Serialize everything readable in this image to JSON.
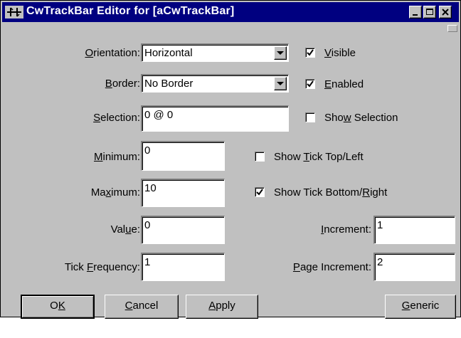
{
  "window": {
    "title": "CwTrackBar Editor for [aCwTrackBar]"
  },
  "orientation": {
    "label_pre": "",
    "label_key": "O",
    "label_post": "rientation:",
    "value": "Horizontal"
  },
  "border": {
    "label_pre": "",
    "label_key": "B",
    "label_post": "order:",
    "value": "No Border"
  },
  "selection": {
    "label_pre": "",
    "label_key": "S",
    "label_post": "election:",
    "value": "0 @ 0"
  },
  "minimum": {
    "label_pre": "",
    "label_key": "M",
    "label_post": "inimum:",
    "value": "0"
  },
  "maximum": {
    "label_pre": "Ma",
    "label_key": "x",
    "label_post": "imum:",
    "value": "10"
  },
  "value_field": {
    "label_pre": "Val",
    "label_key": "u",
    "label_post": "e:",
    "value": "0"
  },
  "tick_frequency": {
    "label_pre": "Tick ",
    "label_key": "F",
    "label_post": "requency:",
    "value": "1"
  },
  "increment": {
    "label_pre": "",
    "label_key": "I",
    "label_post": "ncrement:",
    "value": "1"
  },
  "page_increment": {
    "label_pre": "",
    "label_key": "P",
    "label_post": "age Increment:",
    "value": "2"
  },
  "visible": {
    "pre": "",
    "key": "V",
    "post": "isible",
    "checked": true
  },
  "enabled": {
    "pre": "",
    "key": "E",
    "post": "nabled",
    "checked": true
  },
  "show_selection": {
    "pre": "Sho",
    "key": "w",
    "post": " Selection",
    "checked": false
  },
  "show_tick_top_left": {
    "pre": "Show ",
    "key": "T",
    "post": "ick Top/Left",
    "checked": false
  },
  "show_tick_bottom_right": {
    "pre": "Show Tick Bottom/",
    "key": "R",
    "post": "ight",
    "checked": true
  },
  "buttons": {
    "ok": {
      "pre": "O",
      "key": "K",
      "post": ""
    },
    "cancel": {
      "pre": "",
      "key": "C",
      "post": "ancel"
    },
    "apply": {
      "pre": "",
      "key": "A",
      "post": "pply"
    },
    "generic": {
      "pre": "",
      "key": "G",
      "post": "eneric"
    }
  },
  "colors": {
    "titlebar": "#000080",
    "face": "#c0c0c0",
    "field": "#ffffff"
  }
}
